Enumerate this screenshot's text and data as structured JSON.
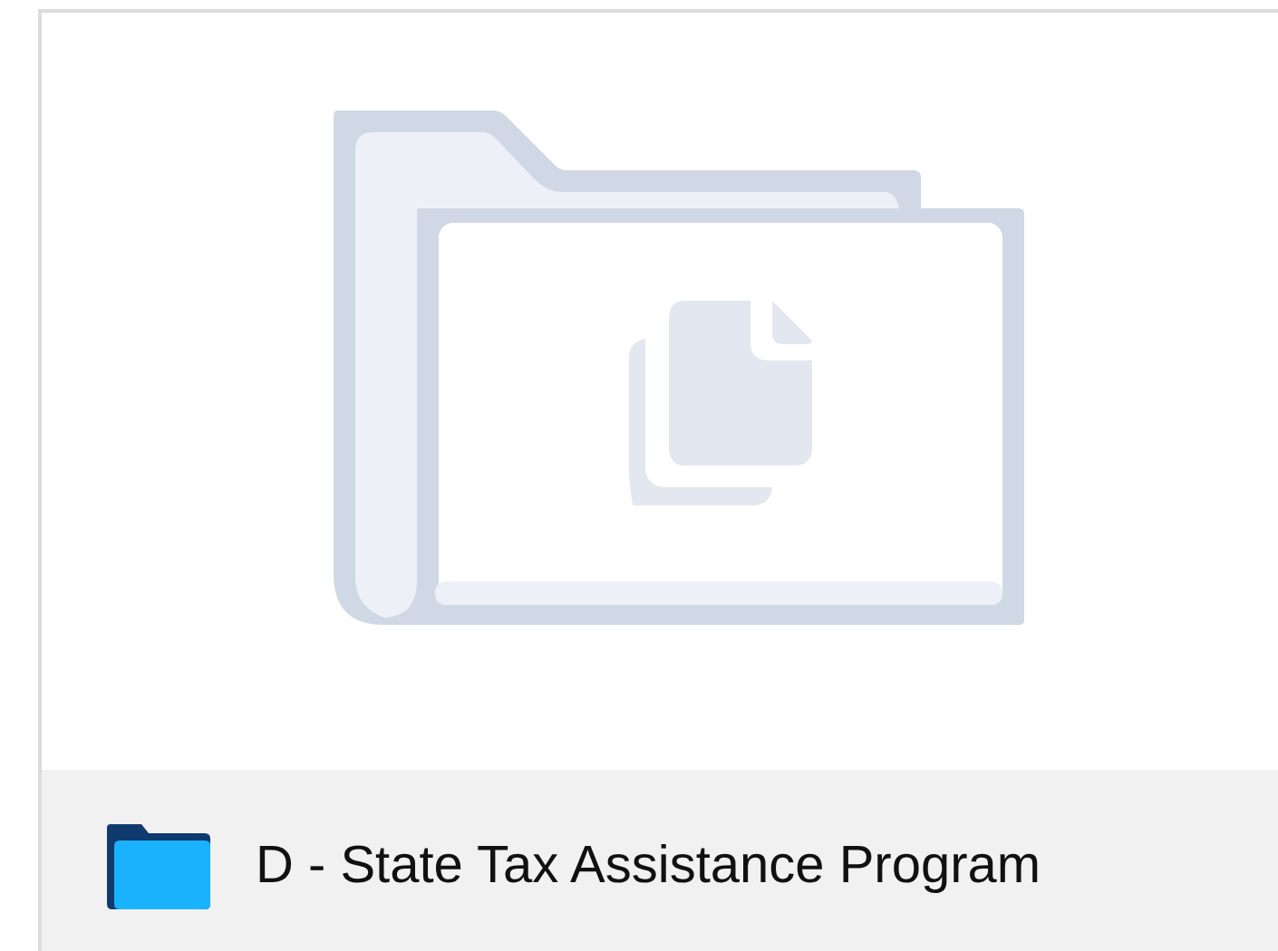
{
  "folder_card": {
    "title": "D - State Tax Assistance Program"
  }
}
